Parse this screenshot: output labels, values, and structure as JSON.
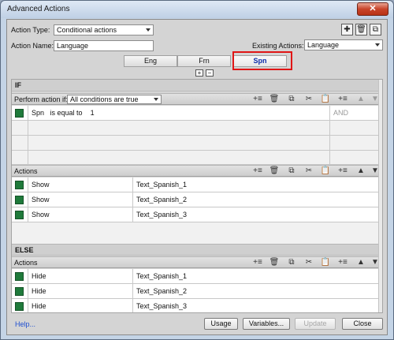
{
  "window": {
    "title": "Advanced Actions",
    "close_glyph": "✕"
  },
  "form": {
    "action_type_label": "Action Type:",
    "action_type_value": "Conditional actions",
    "action_name_label": "Action Name:",
    "action_name_value": "Language",
    "existing_actions_label": "Existing Actions:",
    "existing_actions_value": "Language"
  },
  "top_icons": [
    "plus-icon",
    "trash-icon",
    "duplicate-icon"
  ],
  "tabs": [
    {
      "label": "Eng",
      "active": false
    },
    {
      "label": "Frn",
      "active": false
    },
    {
      "label": "Spn",
      "active": true
    }
  ],
  "tab_buttons": {
    "add": "+",
    "remove": "−"
  },
  "if_section": {
    "heading": "IF",
    "perform_label": "Perform action if:",
    "perform_value": "All conditions are true",
    "conditions": [
      {
        "variable": "Spn",
        "operator": "is equal to",
        "value": "1",
        "logic": "AND"
      }
    ]
  },
  "actions_section": {
    "heading": "Actions",
    "rows": [
      {
        "action": "Show",
        "target": "Text_Spanish_1"
      },
      {
        "action": "Show",
        "target": "Text_Spanish_2"
      },
      {
        "action": "Show",
        "target": "Text_Spanish_3"
      }
    ]
  },
  "else_section": {
    "heading": "ELSE",
    "actions_heading": "Actions",
    "rows": [
      {
        "action": "Hide",
        "target": "Text_Spanish_1"
      },
      {
        "action": "Hide",
        "target": "Text_Spanish_2"
      },
      {
        "action": "Hide",
        "target": "Text_Spanish_3"
      }
    ]
  },
  "toolbar_icons": {
    "insert": "+≡",
    "delete": "🗑",
    "copy": "⧉",
    "cut": "✂",
    "paste": "📋",
    "insert_row": "+≡",
    "up": "▲",
    "down": "▼"
  },
  "footer": {
    "help": "Help...",
    "usage": "Usage",
    "variables": "Variables...",
    "update": "Update",
    "close": "Close"
  },
  "colors": {
    "marker": "#1f7a3b",
    "highlight": "#e01616",
    "active_tab_text": "#0a2aa8"
  }
}
